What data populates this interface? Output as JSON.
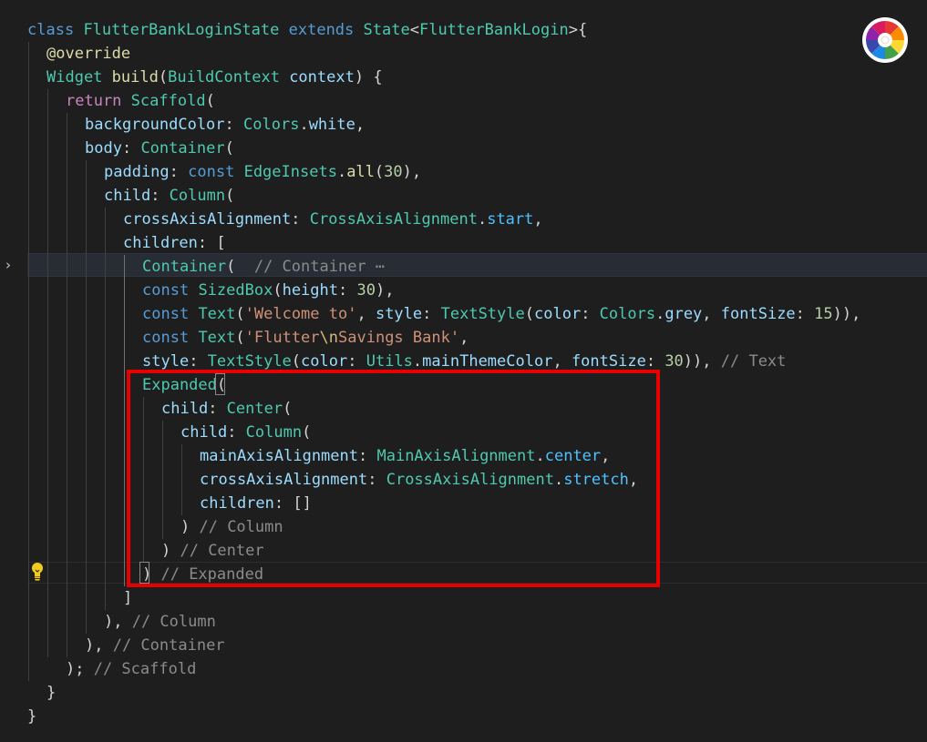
{
  "editor": {
    "lines": [
      [
        [
          "kw",
          "class"
        ],
        [
          "pun",
          " "
        ],
        [
          "cls",
          "FlutterBankLoginState"
        ],
        [
          "pun",
          " "
        ],
        [
          "kw",
          "extends"
        ],
        [
          "pun",
          " "
        ],
        [
          "cls",
          "State"
        ],
        [
          "pun",
          "<"
        ],
        [
          "cls",
          "FlutterBankLogin"
        ],
        [
          "pun",
          ">{"
        ]
      ],
      [
        [
          "fn",
          "@override"
        ]
      ],
      [
        [
          "cls",
          "Widget"
        ],
        [
          "pun",
          " "
        ],
        [
          "fn",
          "build"
        ],
        [
          "pun",
          "("
        ],
        [
          "cls",
          "BuildContext"
        ],
        [
          "pun",
          " "
        ],
        [
          "prop",
          "context"
        ],
        [
          "pun",
          ") {"
        ]
      ],
      [
        [
          "ctl",
          "return"
        ],
        [
          "pun",
          " "
        ],
        [
          "cls",
          "Scaffold"
        ],
        [
          "pun",
          "("
        ]
      ],
      [
        [
          "prop",
          "backgroundColor"
        ],
        [
          "pun",
          ": "
        ],
        [
          "cls",
          "Colors"
        ],
        [
          "pun",
          "."
        ],
        [
          "prop",
          "white"
        ],
        [
          "pun",
          ","
        ]
      ],
      [
        [
          "prop",
          "body"
        ],
        [
          "pun",
          ": "
        ],
        [
          "cls",
          "Container"
        ],
        [
          "pun",
          "("
        ]
      ],
      [
        [
          "prop",
          "padding"
        ],
        [
          "pun",
          ": "
        ],
        [
          "kw",
          "const"
        ],
        [
          "pun",
          " "
        ],
        [
          "cls",
          "EdgeInsets"
        ],
        [
          "pun",
          "."
        ],
        [
          "fn",
          "all"
        ],
        [
          "pun",
          "("
        ],
        [
          "num",
          "30"
        ],
        [
          "pun",
          "),"
        ]
      ],
      [
        [
          "prop",
          "child"
        ],
        [
          "pun",
          ": "
        ],
        [
          "cls",
          "Column"
        ],
        [
          "pun",
          "("
        ]
      ],
      [
        [
          "prop",
          "crossAxisAlignment"
        ],
        [
          "pun",
          ": "
        ],
        [
          "cls",
          "CrossAxisAlignment"
        ],
        [
          "pun",
          "."
        ],
        [
          "enum",
          "start"
        ],
        [
          "pun",
          ","
        ]
      ],
      [
        [
          "prop",
          "children"
        ],
        [
          "pun",
          ": ["
        ]
      ],
      [
        [
          "cls",
          "Container"
        ],
        [
          "pun",
          "(  "
        ],
        [
          "com",
          "// Container"
        ],
        [
          "com",
          " ⋯"
        ]
      ],
      [
        [
          "kw",
          "const"
        ],
        [
          "pun",
          " "
        ],
        [
          "cls",
          "SizedBox"
        ],
        [
          "pun",
          "("
        ],
        [
          "prop",
          "height"
        ],
        [
          "pun",
          ": "
        ],
        [
          "num",
          "30"
        ],
        [
          "pun",
          "),"
        ]
      ],
      [
        [
          "kw",
          "const"
        ],
        [
          "pun",
          " "
        ],
        [
          "cls",
          "Text"
        ],
        [
          "pun",
          "("
        ],
        [
          "str",
          "'Welcome to'"
        ],
        [
          "pun",
          ", "
        ],
        [
          "prop",
          "style"
        ],
        [
          "pun",
          ": "
        ],
        [
          "cls",
          "TextStyle"
        ],
        [
          "pun",
          "("
        ],
        [
          "prop",
          "color"
        ],
        [
          "pun",
          ": "
        ],
        [
          "cls",
          "Colors"
        ],
        [
          "pun",
          "."
        ],
        [
          "prop",
          "grey"
        ],
        [
          "pun",
          ", "
        ],
        [
          "prop",
          "fontSize"
        ],
        [
          "pun",
          ": "
        ],
        [
          "num",
          "15"
        ],
        [
          "pun",
          ")),"
        ]
      ],
      [
        [
          "kw",
          "const"
        ],
        [
          "pun",
          " "
        ],
        [
          "cls",
          "Text"
        ],
        [
          "pun",
          "("
        ],
        [
          "str",
          "'Flutter"
        ],
        [
          "esc",
          "\\n"
        ],
        [
          "str",
          "Savings Bank'"
        ],
        [
          "pun",
          ","
        ]
      ],
      [
        [
          "prop",
          "style"
        ],
        [
          "pun",
          ": "
        ],
        [
          "cls",
          "TextStyle"
        ],
        [
          "pun",
          "("
        ],
        [
          "prop",
          "color"
        ],
        [
          "pun",
          ": "
        ],
        [
          "cls",
          "Utils"
        ],
        [
          "pun",
          "."
        ],
        [
          "prop",
          "mainThemeColor"
        ],
        [
          "pun",
          ", "
        ],
        [
          "prop",
          "fontSize"
        ],
        [
          "pun",
          ": "
        ],
        [
          "num",
          "30"
        ],
        [
          "pun",
          ")), "
        ],
        [
          "com",
          "// Text"
        ]
      ],
      [
        [
          "cls",
          "Expanded"
        ],
        [
          "pun",
          "("
        ]
      ],
      [
        [
          "prop",
          "child"
        ],
        [
          "pun",
          ": "
        ],
        [
          "cls",
          "Center"
        ],
        [
          "pun",
          "("
        ]
      ],
      [
        [
          "prop",
          "child"
        ],
        [
          "pun",
          ": "
        ],
        [
          "cls",
          "Column"
        ],
        [
          "pun",
          "("
        ]
      ],
      [
        [
          "prop",
          "mainAxisAlignment"
        ],
        [
          "pun",
          ": "
        ],
        [
          "cls",
          "MainAxisAlignment"
        ],
        [
          "pun",
          "."
        ],
        [
          "enum",
          "center"
        ],
        [
          "pun",
          ","
        ]
      ],
      [
        [
          "prop",
          "crossAxisAlignment"
        ],
        [
          "pun",
          ": "
        ],
        [
          "cls",
          "CrossAxisAlignment"
        ],
        [
          "pun",
          "."
        ],
        [
          "enum",
          "stretch"
        ],
        [
          "pun",
          ","
        ]
      ],
      [
        [
          "prop",
          "children"
        ],
        [
          "pun",
          ": []"
        ]
      ],
      [
        [
          "pun",
          ") "
        ],
        [
          "com",
          "// Column"
        ]
      ],
      [
        [
          "pun",
          ") "
        ],
        [
          "com",
          "// Center"
        ]
      ],
      [
        [
          "pun",
          ") "
        ],
        [
          "com",
          "// Expanded"
        ]
      ],
      [
        [
          "pun",
          "]"
        ]
      ],
      [
        [
          "pun",
          "), "
        ],
        [
          "com",
          "// Column"
        ]
      ],
      [
        [
          "pun",
          "), "
        ],
        [
          "com",
          "// Container"
        ]
      ],
      [
        [
          "pun",
          "); "
        ],
        [
          "com",
          "// Scaffold"
        ]
      ],
      [
        [
          "pun",
          "}"
        ]
      ],
      [
        [
          "pun",
          "}"
        ]
      ]
    ]
  },
  "icons": {
    "fold": "chevron-right-icon",
    "lightbulb": "lightbulb-icon",
    "extension": "color-wheel-icon"
  },
  "colors": {
    "background": "#1e1e1e",
    "annotation": "#e60000",
    "keyword": "#569cd6",
    "control": "#c586c0",
    "type": "#4ec9b0",
    "function": "#dcdcaa",
    "property": "#9cdcfe",
    "string": "#ce9178",
    "number": "#b5cea8",
    "comment": "#8b8b8b"
  }
}
